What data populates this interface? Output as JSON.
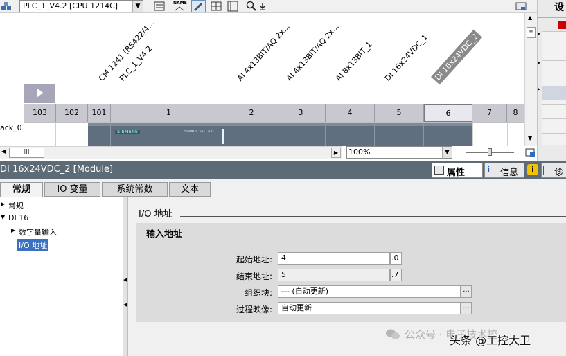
{
  "toolbar": {
    "device_select": "PLC_1_V4.2 [CPU 1214C]",
    "name_icon_label": "NAME"
  },
  "right_strip": {
    "label": "设"
  },
  "modules": {
    "cm1241": "CM 1241 (RS422/4...",
    "plc": "PLC_1_V4.2",
    "ai1": "AI 4x13BIT/AQ 2x...",
    "ai2": "AI 4x13BIT/AQ 2x...",
    "ai3": "AI 8x13BIT_1",
    "di1": "DI 16x24VDC_1",
    "di2": "DI 16x24VDC_2"
  },
  "slots": [
    "103",
    "102",
    "101",
    "1",
    "2",
    "3",
    "4",
    "5",
    "6",
    "7",
    "8"
  ],
  "rack_label": "ack_0",
  "module_brand": "SIEMENS",
  "module_model": "SIMATIC S7-1200",
  "zoom": {
    "value": "100%"
  },
  "inspector": {
    "title": "DI 16x24VDC_2 [Module]",
    "tabs": {
      "properties": "属性",
      "info": "信息",
      "diag": "诊"
    }
  },
  "tabs": [
    "常规",
    "IO 变量",
    "系统常数",
    "文本"
  ],
  "nav": {
    "general": "常规",
    "di16": "DI 16",
    "digital_input": "数字量输入",
    "io_address": "I/O 地址"
  },
  "section": {
    "title": "I/O 地址",
    "sub_title": "输入地址",
    "start_label": "起始地址:",
    "start_value": "4",
    "start_bit": ".0",
    "end_label": "结束地址:",
    "end_value": "5",
    "end_bit": ".7",
    "ob_label": "组织块:",
    "ob_value": "--- (自动更新)",
    "pi_label": "过程映像:",
    "pi_value": "自动更新"
  },
  "watermark": {
    "wechat": "公众号 · 电子技术控",
    "toutiao": "头条 @工控大卫"
  }
}
